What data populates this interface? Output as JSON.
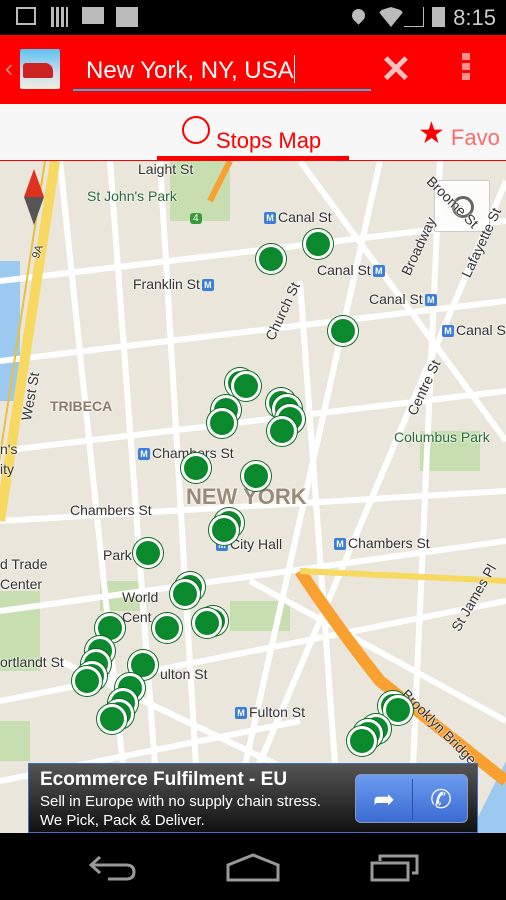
{
  "status_bar": {
    "time": "8:15",
    "icons": [
      "image-icon",
      "barcode-icon",
      "gmail-icon",
      "clipboard-check-icon",
      "location-icon",
      "wifi-icon",
      "signal-icon",
      "battery-icon"
    ]
  },
  "app_bar": {
    "search_value": "New York, NY, USA",
    "clear_icon": "close-icon",
    "menu_icon": "overflow-menu-icon",
    "color": "#ff0000"
  },
  "tabs": [
    {
      "label": "Stops Map",
      "icon": "circle-icon",
      "selected": true
    },
    {
      "label": "Favo",
      "icon": "star-icon",
      "selected": false
    }
  ],
  "map": {
    "labels": {
      "laight": "Laight St",
      "stjohns": "St John's Park",
      "route4": "4",
      "canal1": "Canal St",
      "broome": "Broome St",
      "franklin": "Franklin St",
      "canal2": "Canal St",
      "church": "Church St",
      "broadway": "Broadway",
      "lafayette": "Lafayette St",
      "canal3": "Canal St",
      "canal4": "Canal St",
      "west": "West St",
      "route9a": "9A",
      "tribeca": "TRIBECA",
      "centre": "Centre St",
      "columbus": "Columbus Park",
      "chambers1": "Chambers St",
      "newyork": "NEW YORK",
      "chambers2": "Chambers St",
      "cityhall": "City Hall",
      "chambers3": "Chambers St",
      "park": "Park",
      "wtc1": "World",
      "wtc2": "Cent",
      "wtc3": "d Trade",
      "wtc4": "Center",
      "stjames": "St James Pl",
      "cortlandt": "ortlandt St",
      "fulton1": "ulton St",
      "fulton2": "Fulton St",
      "brooklyn": "Brooklyn Bridge",
      "hosp1": "n's",
      "hosp2": "ity",
      "metro": "M"
    },
    "stop_marker_color": "#0a8a2c"
  },
  "ad": {
    "title": "Ecommerce Fulfilment - EU",
    "line1": "Sell in Europe with no supply chain stress.",
    "line2": "We Pick, Pack & Deliver.",
    "buttons": [
      {
        "icon": "share-arrow-icon"
      },
      {
        "icon": "phone-icon"
      }
    ]
  },
  "nav_bar": {
    "buttons": [
      "back-icon",
      "home-icon",
      "recent-apps-icon"
    ]
  }
}
